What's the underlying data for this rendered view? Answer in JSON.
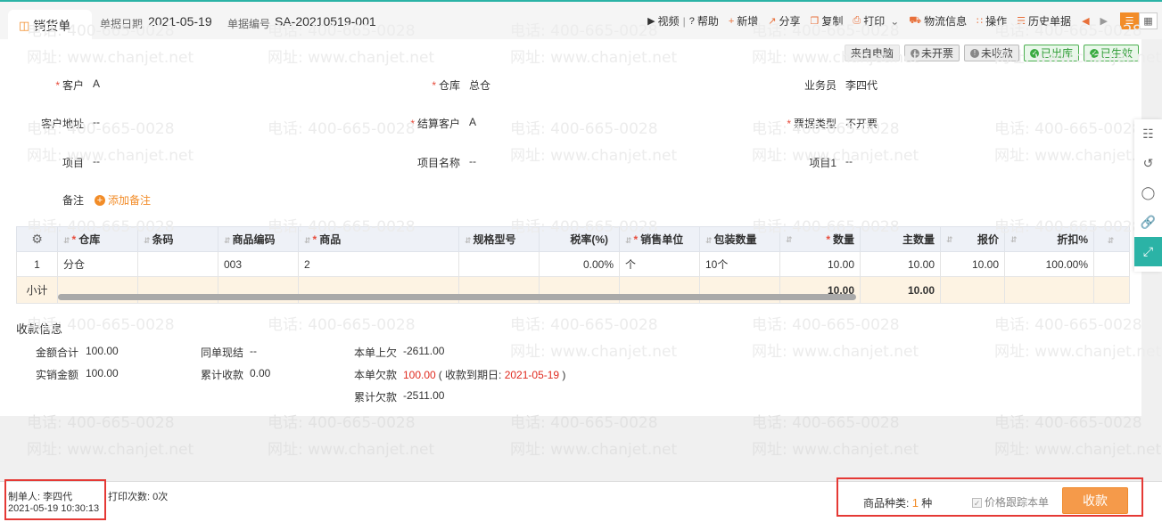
{
  "header": {
    "tab_title": "销货单",
    "date_label": "单据日期",
    "date_value": "2021-05-19",
    "number_label": "单据编号",
    "number_value": "SA-20210519-001",
    "tools": {
      "video": "视频",
      "help": "帮助",
      "add": "新增",
      "share": "分享",
      "copy": "复制",
      "print": "打印",
      "logistics": "物流信息",
      "operate": "操作",
      "history": "历史单据"
    }
  },
  "status_badges": [
    "来自电脑",
    "未开票",
    "未收款",
    "已出库",
    "已生效"
  ],
  "form": {
    "customer_label": "客户",
    "customer_value": "A",
    "warehouse_label": "仓库",
    "warehouse_value": "总仓",
    "salesman_label": "业务员",
    "salesman_value": "李四代",
    "address_label": "客户地址",
    "address_value": "--",
    "settle_label": "结算客户",
    "settle_value": "A",
    "invoice_label": "票据类型",
    "invoice_value": "不开票",
    "project_label": "项目",
    "project_value": "--",
    "project_name_label": "项目名称",
    "project_name_value": "--",
    "project1_label": "项目1",
    "project1_value": "--",
    "note_label": "备注",
    "add_note": "添加备注"
  },
  "table": {
    "headers": [
      "仓库",
      "条码",
      "商品编码",
      "商品",
      "规格型号",
      "税率(%)",
      "销售单位",
      "包装数量",
      "数量",
      "主数量",
      "报价",
      "折扣%"
    ],
    "row": {
      "index": "1",
      "warehouse": "分仓",
      "barcode": "",
      "code": "003",
      "product": "2",
      "spec": "",
      "tax": "0.00%",
      "unit": "个",
      "pack": "10个",
      "qty": "10.00",
      "main_qty": "10.00",
      "price": "10.00",
      "discount": "100.00%"
    },
    "subtotal_label": "小计",
    "subtotal_qty": "10.00",
    "subtotal_main_qty": "10.00"
  },
  "receipt": {
    "title": "收款信息",
    "total_label": "金额合计",
    "total_value": "100.00",
    "actual_label": "实销金额",
    "actual_value": "100.00",
    "cash_label": "同单现结",
    "cash_value": "--",
    "cum_label": "累计收款",
    "cum_value": "0.00",
    "prev_label": "本单上欠",
    "prev_value": "-2611.00",
    "owe_label": "本单欠款",
    "owe_value": "100.00",
    "owe_open": "( 收款到期日: ",
    "owe_due": "2021-05-19",
    "owe_close": " )",
    "cum_owe_label": "累计欠款",
    "cum_owe_value": "-2511.00"
  },
  "footer": {
    "maker_label": "制单人:",
    "maker_value": "李四代",
    "maker_time": "2021-05-19 10:30:13",
    "print_label": "打印次数:",
    "print_value": "0次",
    "kinds_label": "商品种类:",
    "kinds_value": "1",
    "kinds_unit": "种",
    "track_label": "价格跟踪本单",
    "pay_button": "收款"
  },
  "watermark": {
    "phone": "电话: 400-665-0028",
    "site": "网址: www.chanjet.net"
  },
  "colors": {
    "accent": "#f28c28",
    "teal": "#2bb3a6",
    "red": "#e02b20",
    "highlight_box": "#e53935"
  }
}
